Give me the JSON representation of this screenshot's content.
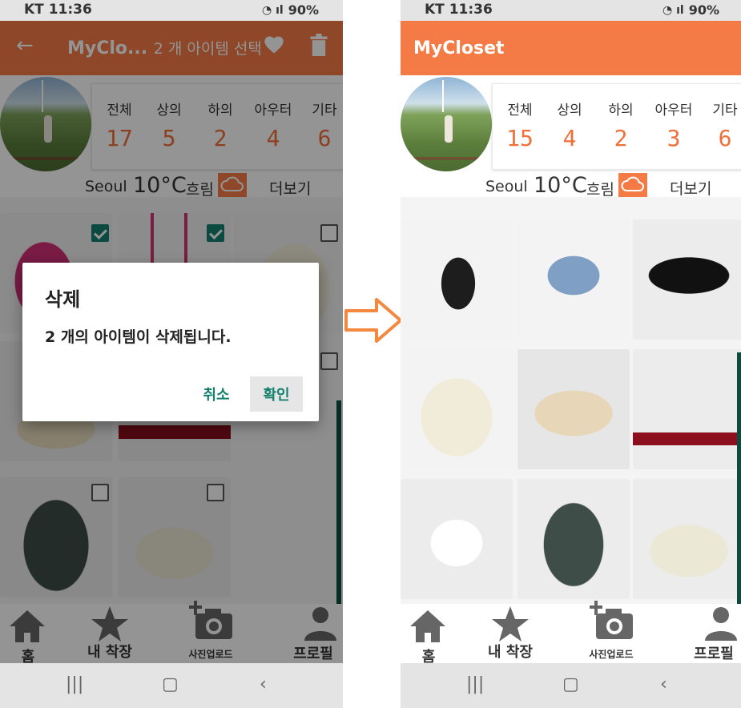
{
  "status_bar": {
    "carrier_time": "KT 11:36",
    "battery": "90%"
  },
  "left": {
    "app_bar": {
      "title": "MyClo...",
      "selection_text": "2 개 아이템 선택"
    },
    "categories": [
      {
        "label": "전체",
        "count": "17"
      },
      {
        "label": "상의",
        "count": "5"
      },
      {
        "label": "하의",
        "count": "2"
      },
      {
        "label": "아우터",
        "count": "4"
      },
      {
        "label": "기타",
        "count": "6"
      }
    ],
    "dialog": {
      "title": "삭제",
      "message": "2 개의 아이템이 삭제됩니다.",
      "cancel": "취소",
      "confirm": "확인"
    }
  },
  "right": {
    "app_bar": {
      "title": "MyCloset"
    },
    "categories": [
      {
        "label": "전체",
        "count": "15"
      },
      {
        "label": "상의",
        "count": "4"
      },
      {
        "label": "하의",
        "count": "2"
      },
      {
        "label": "아우터",
        "count": "3"
      },
      {
        "label": "기타",
        "count": "6"
      }
    ]
  },
  "weather": {
    "city": "Seoul",
    "temperature": "10°C",
    "condition": "흐림",
    "more": "더보기"
  },
  "nav": {
    "home": "홈",
    "closet": "내 착장",
    "upload": "사진업로드",
    "profile": "프로필"
  },
  "colors": {
    "accent": "#f47b45",
    "number": "#f0703a",
    "dialog_button": "#14806e"
  },
  "icons": [
    "back-arrow-icon",
    "heart-icon",
    "trash-icon",
    "cloud-icon",
    "home-icon",
    "star-icon",
    "camera-add-icon",
    "person-icon",
    "recent-apps-icon",
    "home-circle-icon",
    "back-chevron-icon"
  ]
}
